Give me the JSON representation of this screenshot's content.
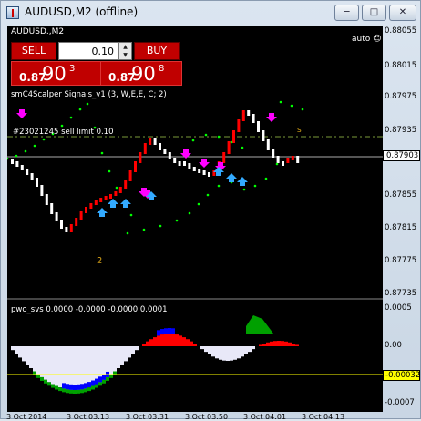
{
  "window": {
    "title": "AUDUSD,M2 (offline)",
    "min_glyph": "─",
    "max_glyph": "□",
    "close_glyph": "✕"
  },
  "chart": {
    "symbol_label": "AUDUSD.,M2",
    "auto_label": "auto ☺",
    "indicator_label": "smC4Scalper Signals_v1 (3, W,E,E, C; 2)",
    "order_line_label": "#23021245 sell limit 0.10",
    "signal_number": "2",
    "s_marker": "s"
  },
  "trade_panel": {
    "sell_label": "SELL",
    "buy_label": "BUY",
    "lot_value": "0.10",
    "bid": {
      "prefix": "0.87",
      "big": "90",
      "sup": "3"
    },
    "ask": {
      "prefix": "0.87",
      "big": "90",
      "sup": "8"
    }
  },
  "price_axis": [
    "0.88055",
    "0.88015",
    "0.87975",
    "0.87935",
    "0.87903",
    "0.87855",
    "0.87815",
    "0.87775",
    "0.87735"
  ],
  "current_price": "0.87903",
  "subwindow": {
    "label": "pwo_svs 0.0000 -0.0000 -0.0000 0.0001",
    "axis": [
      "0.0005",
      "0.00",
      "-0.0007"
    ],
    "current_value": "-0.00032"
  },
  "time_axis": [
    "3 Oct 2014",
    "3 Oct 03:13",
    "3 Oct 03:31",
    "3 Oct 03:50",
    "3 Oct 04:01",
    "3 Oct 04:13"
  ],
  "colors": {
    "bull": "#ff0000",
    "bear": "#ffffff",
    "signal_dots": "#00ff00",
    "order_line": "#ffff00",
    "hist_pos": "#ff0000",
    "hist_blue": "#0000ff",
    "hist_green": "#00a000",
    "hist_white": "#e8e8f8"
  }
}
